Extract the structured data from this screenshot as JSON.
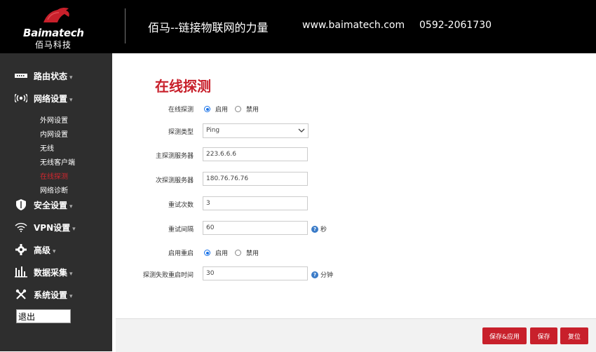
{
  "header": {
    "brand": "Baimatech",
    "brand_cn": "佰马科技",
    "slogan": "佰马--链接物联网的力量",
    "url": "www.baimatech.com",
    "phone": "0592-2061730"
  },
  "sidebar": {
    "items": [
      {
        "label": "路由状态",
        "icon": "router-icon"
      },
      {
        "label": "网络设置",
        "icon": "network-icon"
      },
      {
        "label": "安全设置",
        "icon": "shield-icon"
      },
      {
        "label": "VPN设置",
        "icon": "wifi-signal-icon"
      },
      {
        "label": "高级",
        "icon": "gear-icon"
      },
      {
        "label": "数据采集",
        "icon": "data-collection-icon"
      },
      {
        "label": "系统设置",
        "icon": "tools-icon"
      }
    ],
    "caret": "▾",
    "network_sub": [
      "外网设置",
      "内网设置",
      "无线",
      "无线客户端",
      "在线探测",
      "网络诊断"
    ],
    "logout": "退出"
  },
  "main": {
    "title": "在线探测",
    "probe_enable": {
      "label": "在线探测",
      "on": "启用",
      "off": "禁用",
      "selected": "启用"
    },
    "probe_type": {
      "label": "探测类型",
      "value": "Ping"
    },
    "primary_server": {
      "label": "主探测服务器",
      "value": "223.6.6.6"
    },
    "secondary_server": {
      "label": "次探测服务器",
      "value": "180.76.76.76"
    },
    "retries": {
      "label": "重试次数",
      "value": "3"
    },
    "retry_interval": {
      "label": "重试间隔",
      "value": "60",
      "unit": "秒"
    },
    "reboot_enable": {
      "label": "启用重启",
      "on": "启用",
      "off": "禁用",
      "selected": "启用"
    },
    "reboot_time": {
      "label": "探测失败重启时间",
      "value": "30",
      "unit": "分钟"
    }
  },
  "footer": {
    "save_apply": "保存&应用",
    "save": "保存",
    "reset": "复位"
  },
  "colors": {
    "accent": "#c8202b",
    "sidebar_bg": "#2e2e2e",
    "header_bg": "#000000",
    "active_sub": "#d2272f"
  }
}
